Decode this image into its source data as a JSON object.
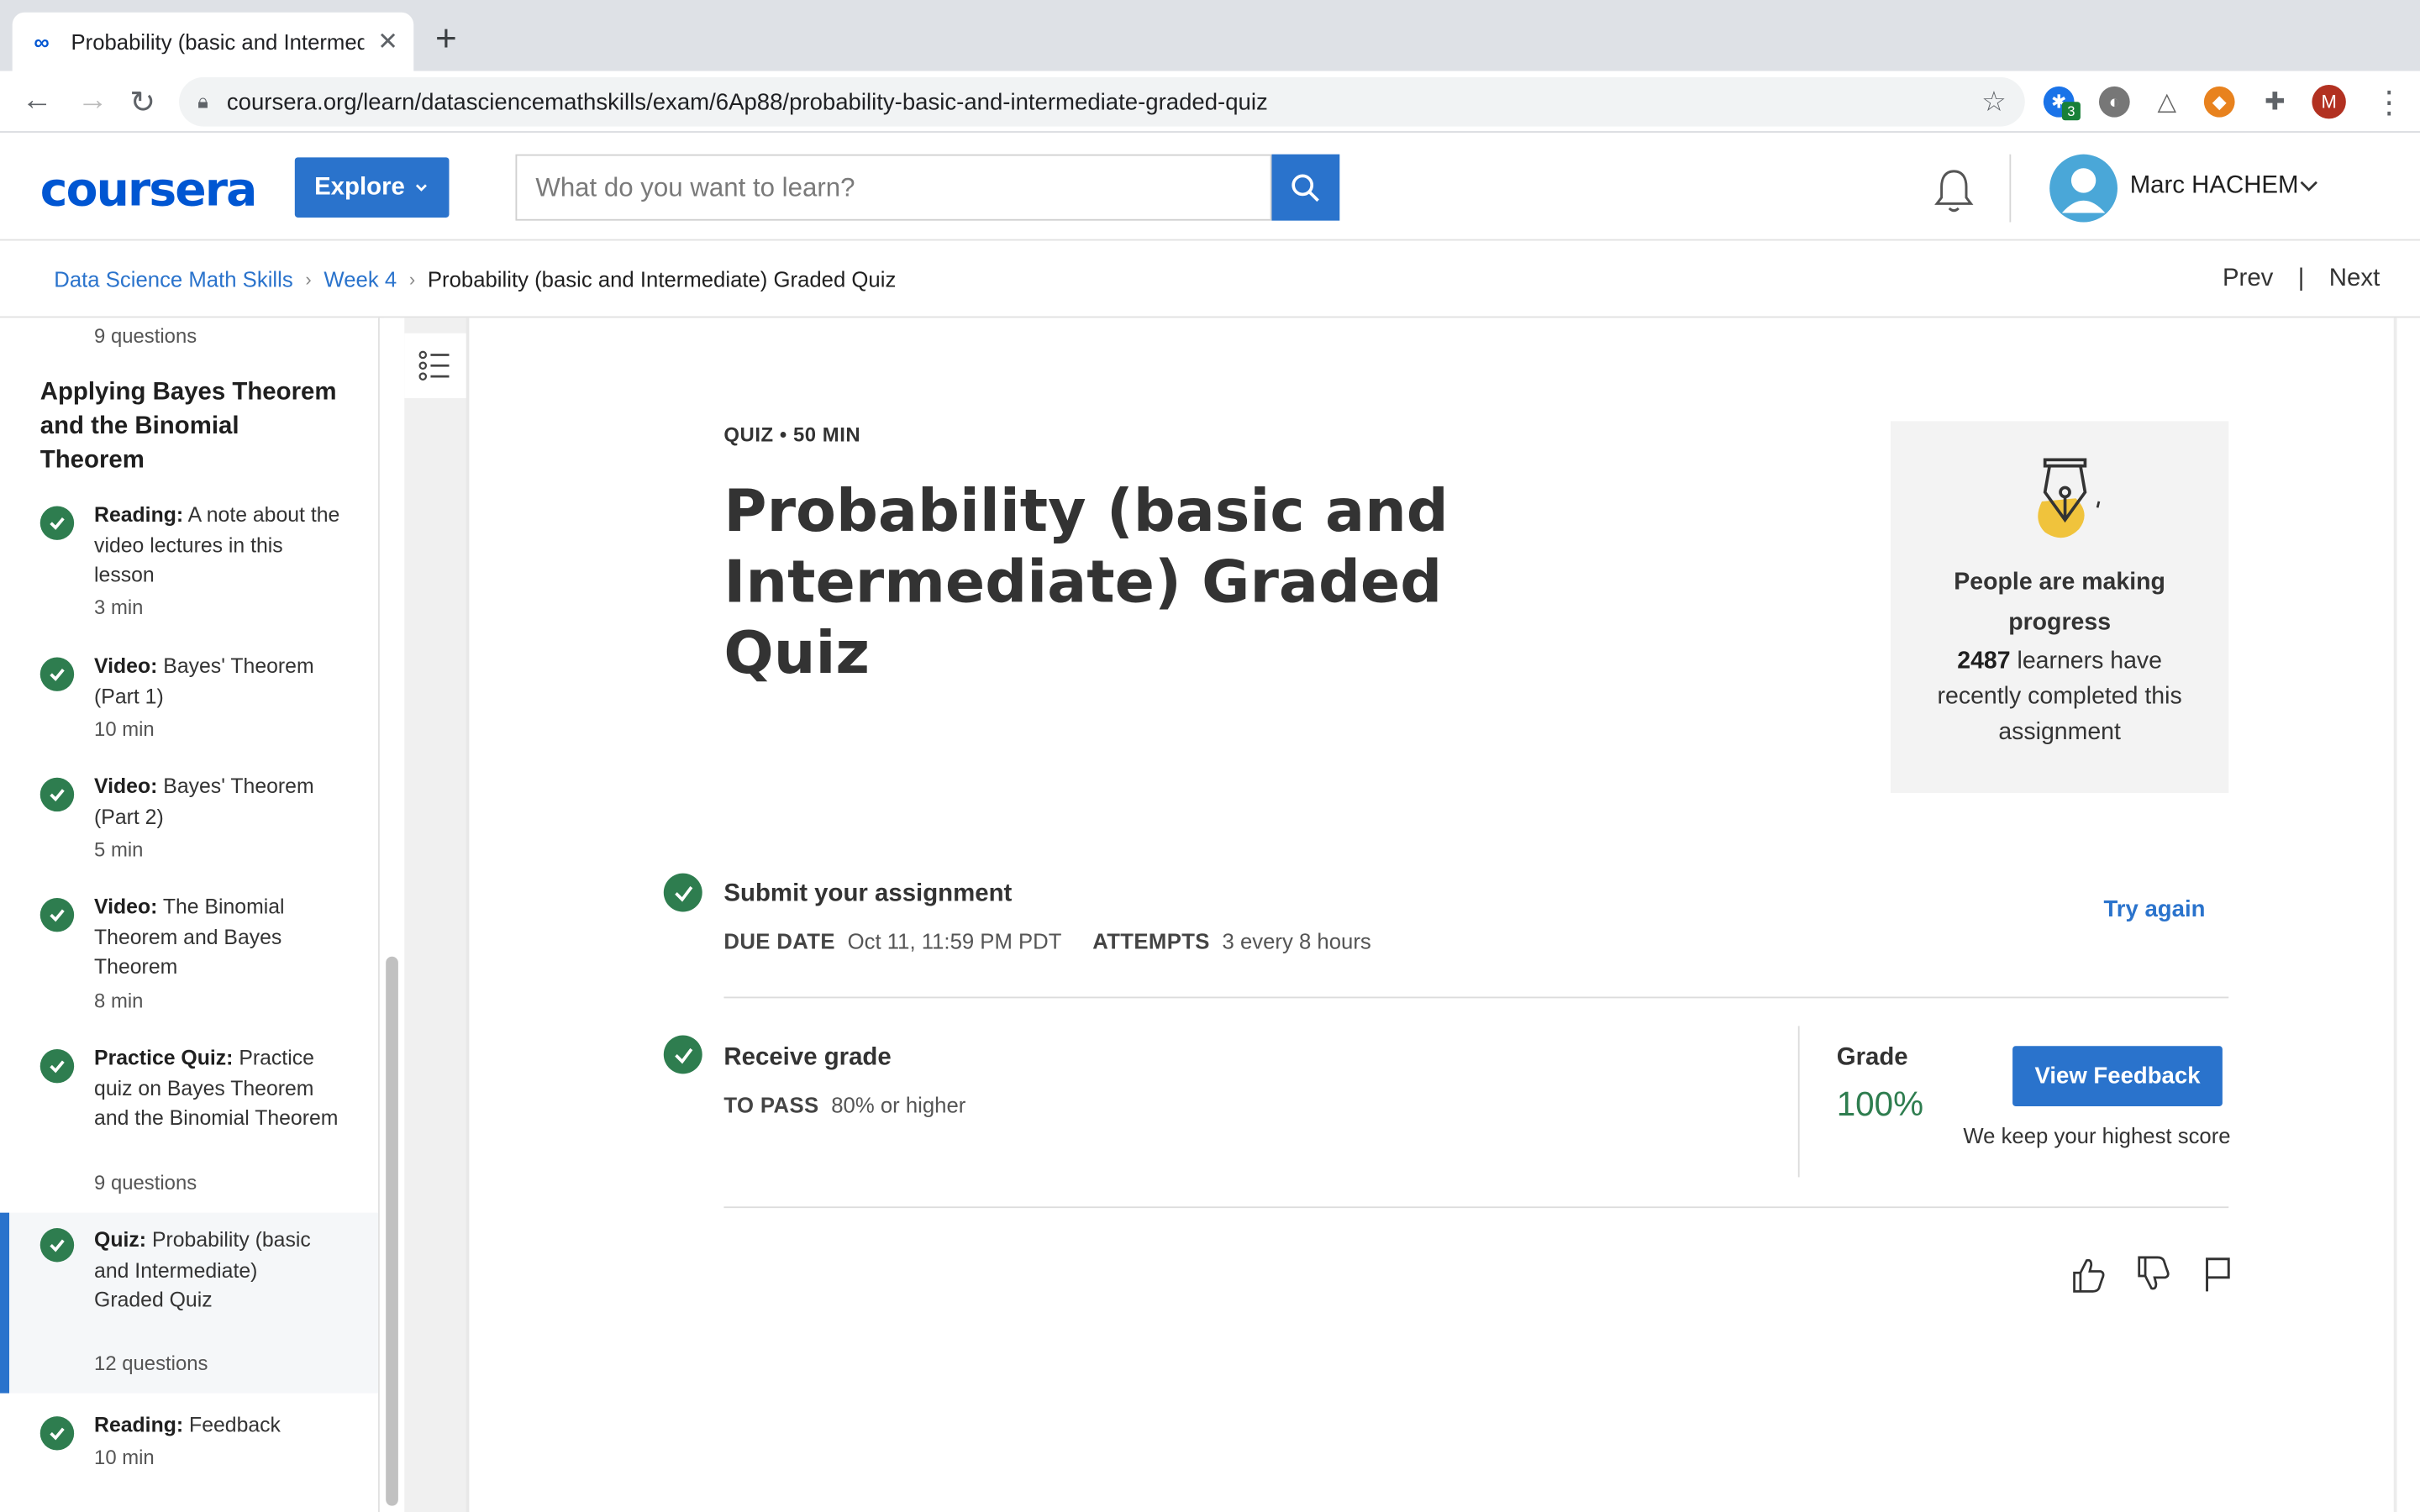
{
  "browser": {
    "tab_title": "Probability (basic and Intermed",
    "tab_close": "✕",
    "new_tab": "+",
    "url": "coursera.org/learn/datasciencemathskills/exam/6Ap88/probability-basic-and-intermediate-graded-quiz",
    "ext_badge": "3",
    "profile_initial": "M"
  },
  "header": {
    "logo": "coursera",
    "explore": "Explore",
    "search_placeholder": "What do you want to learn?",
    "user_name": "Marc HACHEM"
  },
  "breadcrumb": {
    "items": [
      "Data Science Math Skills",
      "Week 4",
      "Probability (basic and Intermediate) Graded Quiz"
    ],
    "prev": "Prev",
    "separator": "|",
    "next": "Next"
  },
  "sidebar": {
    "top_meta": "9 questions",
    "section_heading": "Applying Bayes Theorem and the Binomial Theorem",
    "items": [
      {
        "type": "Reading:",
        "title": "A note about the video lectures in this lesson",
        "meta": "3 min"
      },
      {
        "type": "Video:",
        "title": "Bayes' Theorem (Part 1)",
        "meta": "10 min"
      },
      {
        "type": "Video:",
        "title": "Bayes' Theorem (Part 2)",
        "meta": "5 min"
      },
      {
        "type": "Video:",
        "title": "The Binomial Theorem and Bayes Theorem",
        "meta": "8 min"
      },
      {
        "type": "Practice Quiz:",
        "title": "Practice quiz on Bayes Theorem and the Binomial Theorem",
        "meta": "9 questions"
      },
      {
        "type": "Quiz:",
        "title": "Probability (basic and Intermediate) Graded Quiz",
        "meta": "12 questions"
      },
      {
        "type": "Reading:",
        "title": "Feedback",
        "meta": "10 min"
      }
    ]
  },
  "main": {
    "label": "QUIZ • 50 MIN",
    "title": "Probability (basic and Intermediate) Graded Quiz",
    "progress_card": {
      "title": "People are making progress",
      "count": "2487",
      "desc": "learners have recently completed this assignment"
    },
    "submit": {
      "title": "Submit your assignment",
      "due_label": "DUE DATE",
      "due_value": "Oct 11, 11:59 PM PDT",
      "attempts_label": "ATTEMPTS",
      "attempts_value": "3 every 8 hours",
      "try_again": "Try again"
    },
    "grade": {
      "title": "Receive grade",
      "pass_label": "TO PASS",
      "pass_value": "80% or higher",
      "grade_label": "Grade",
      "grade_value": "100%",
      "view_feedback": "View Feedback",
      "keep_score": "We keep your highest score"
    }
  },
  "colors": {
    "brand_blue": "#2a73cc",
    "success_green": "#2e7d4f",
    "logo_blue": "#0056d2"
  }
}
